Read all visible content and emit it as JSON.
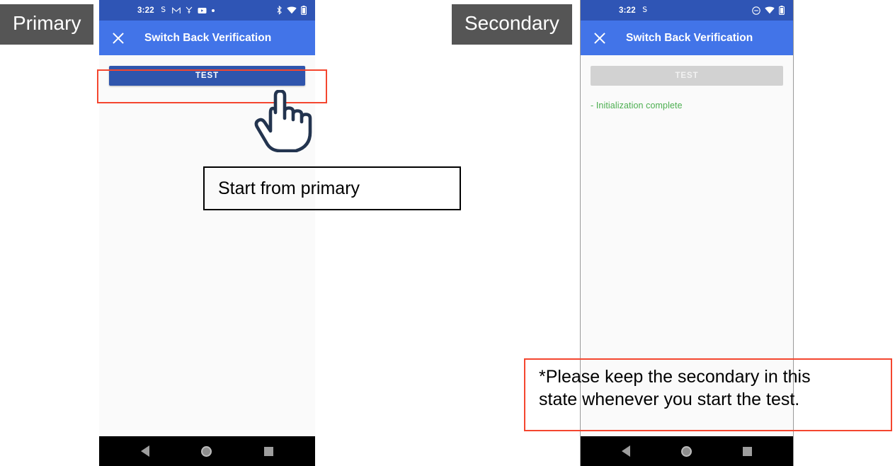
{
  "labels": {
    "primary": "Primary",
    "secondary": "Secondary"
  },
  "colors": {
    "status_bar": "#2f55b5",
    "app_bar": "#4274e8",
    "button_enabled": "#2f55ad",
    "button_disabled": "#d2d2d2",
    "log_green": "#4caf50",
    "annotation_red": "#f4462f",
    "label_gray": "#555555",
    "screen_bg": "#fafafa"
  },
  "primary_phone": {
    "status_bar": {
      "time": "3:22",
      "left_icons": [
        "skype-icon",
        "mail-icon",
        "wrench-icon",
        "youtube-icon",
        "more-dot-icon"
      ],
      "right_icons": [
        "bluetooth-icon",
        "wifi-icon",
        "battery-icon"
      ]
    },
    "app_bar": {
      "close_icon": "close-icon",
      "title": "Switch Back Verification"
    },
    "body": {
      "test_button_label": "TEST",
      "test_button_state": "enabled",
      "log_text": ""
    },
    "nav_bar": {
      "back_icon": "back-triangle-icon",
      "home_icon": "home-circle-icon",
      "recents_icon": "recents-square-icon"
    }
  },
  "secondary_phone": {
    "status_bar": {
      "time": "3:22",
      "left_icons": [
        "skype-icon"
      ],
      "right_icons": [
        "do-not-disturb-icon",
        "wifi-icon",
        "battery-icon"
      ]
    },
    "app_bar": {
      "close_icon": "close-icon",
      "title": "Switch Back Verification"
    },
    "body": {
      "test_button_label": "TEST",
      "test_button_state": "disabled",
      "log_text": "- Initialization complete"
    },
    "nav_bar": {
      "back_icon": "back-triangle-icon",
      "home_icon": "home-circle-icon",
      "recents_icon": "recents-square-icon"
    }
  },
  "annotations": {
    "primary_callout": "Start from primary",
    "secondary_note_line1": "*Please keep the secondary in this",
    "secondary_note_line2": "state whenever you start the test.",
    "highlight_target": "test-button-highlight",
    "cursor": "pointing-hand-cursor"
  }
}
